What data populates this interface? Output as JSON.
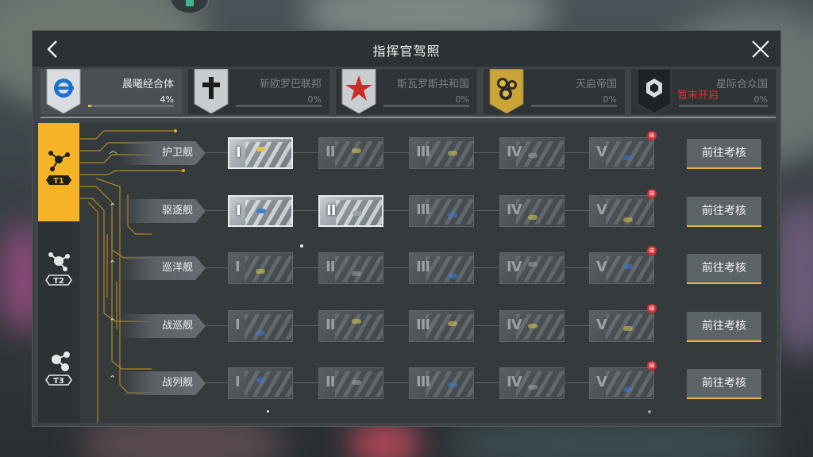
{
  "title": "指挥官驾照",
  "factions": [
    {
      "name": "晨曦经合体",
      "percent": "4%",
      "progress": 0.04,
      "active": true,
      "icon": "dawn-emblem-icon"
    },
    {
      "name": "新欧罗巴联邦",
      "percent": "0%",
      "progress": 0,
      "active": false,
      "icon": "cross-emblem-icon"
    },
    {
      "name": "斯瓦罗斯共和国",
      "percent": "0%",
      "progress": 0,
      "active": false,
      "icon": "star-emblem-icon"
    },
    {
      "name": "天启帝国",
      "percent": "0%",
      "progress": 0,
      "active": false,
      "icon": "cluster-emblem-icon"
    },
    {
      "name": "星际合众国",
      "percent": "0%",
      "progress": 0,
      "active": false,
      "icon": "hex-emblem-icon",
      "locked_text": "暂未开启"
    }
  ],
  "tiers": [
    {
      "label": "T1",
      "active": true
    },
    {
      "label": "T2",
      "active": false
    },
    {
      "label": "T3",
      "active": false
    }
  ],
  "numerals": [
    "I",
    "II",
    "III",
    "IV",
    "V"
  ],
  "rows": [
    {
      "label": "护卫舰",
      "unlocked": 1,
      "button": "前往考核"
    },
    {
      "label": "驱逐舰",
      "unlocked": 2,
      "button": "前往考核"
    },
    {
      "label": "巡洋舰",
      "unlocked": 0,
      "button": "前往考核"
    },
    {
      "label": "战巡舰",
      "unlocked": 0,
      "button": "前往考核"
    },
    {
      "label": "战列舰",
      "unlocked": 0,
      "button": "前往考核"
    }
  ],
  "colors": {
    "accent": "#f5b325",
    "locked": "#e03131",
    "gift_badge": "#d6303a"
  }
}
